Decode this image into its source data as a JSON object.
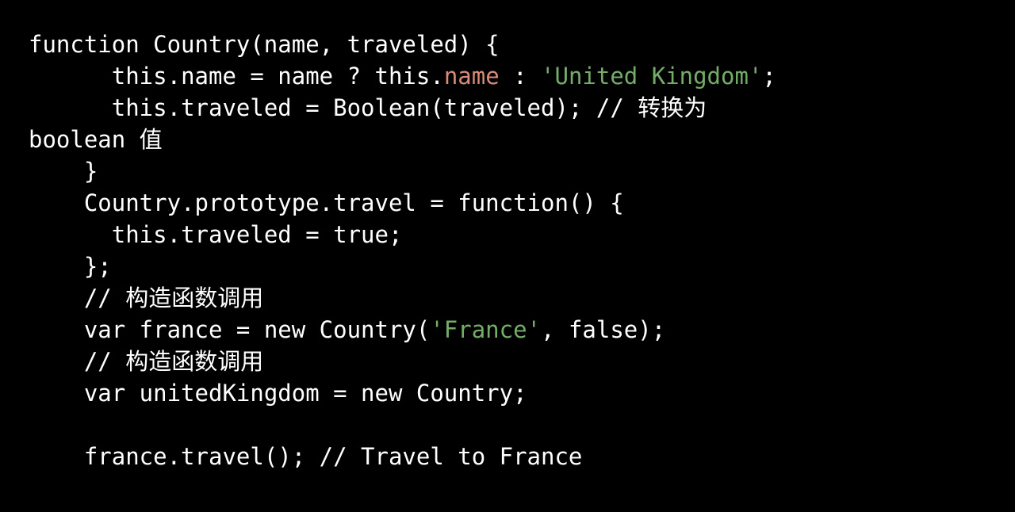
{
  "editor": {
    "background_color": "#000000",
    "default_text_color": "#ffffff",
    "property_color": "#d98c77",
    "string_color": "#74ad68",
    "font_size_px": 29,
    "line_height_px": 40,
    "language": "javascript"
  },
  "code": {
    "lines": [
      {
        "id": "line-1",
        "indent": "",
        "tokens": [
          {
            "kind": "plain",
            "text": "function Country(name, traveled) {"
          }
        ]
      },
      {
        "id": "line-2",
        "indent": "      ",
        "tokens": [
          {
            "kind": "plain",
            "text": "this."
          },
          {
            "kind": "plain",
            "text": "name = name ? this."
          },
          {
            "kind": "prop",
            "text": "name"
          },
          {
            "kind": "plain",
            "text": " : "
          },
          {
            "kind": "string",
            "text": "'United Kingdom'"
          },
          {
            "kind": "plain",
            "text": ";"
          }
        ]
      },
      {
        "id": "line-3",
        "indent": "      ",
        "tokens": [
          {
            "kind": "plain",
            "text": "this.traveled = Boolean(traveled); "
          },
          {
            "kind": "comment",
            "text": "// 转换为"
          }
        ]
      },
      {
        "id": "line-4-wrap",
        "indent": "",
        "tokens": [
          {
            "kind": "comment",
            "text": "boolean 值"
          }
        ]
      },
      {
        "id": "line-5",
        "indent": "    ",
        "tokens": [
          {
            "kind": "plain",
            "text": "}"
          }
        ]
      },
      {
        "id": "line-6",
        "indent": "    ",
        "tokens": [
          {
            "kind": "plain",
            "text": "Country.prototype.travel = function() {"
          }
        ]
      },
      {
        "id": "line-7",
        "indent": "      ",
        "tokens": [
          {
            "kind": "plain",
            "text": "this.traveled = true;"
          }
        ]
      },
      {
        "id": "line-8",
        "indent": "    ",
        "tokens": [
          {
            "kind": "plain",
            "text": "};"
          }
        ]
      },
      {
        "id": "line-9",
        "indent": "    ",
        "tokens": [
          {
            "kind": "comment",
            "text": "// 构造函数调用"
          }
        ]
      },
      {
        "id": "line-10",
        "indent": "    ",
        "tokens": [
          {
            "kind": "plain",
            "text": "var france = new Country("
          },
          {
            "kind": "string",
            "text": "'France'"
          },
          {
            "kind": "plain",
            "text": ", false);"
          }
        ]
      },
      {
        "id": "line-11",
        "indent": "    ",
        "tokens": [
          {
            "kind": "comment",
            "text": "// 构造函数调用"
          }
        ]
      },
      {
        "id": "line-12",
        "indent": "    ",
        "tokens": [
          {
            "kind": "plain",
            "text": "var unitedKingdom = new Country;"
          }
        ]
      },
      {
        "id": "line-13-blank",
        "indent": "",
        "tokens": []
      },
      {
        "id": "line-14",
        "indent": "    ",
        "tokens": [
          {
            "kind": "plain",
            "text": "france.travel(); "
          },
          {
            "kind": "comment",
            "text": "// Travel to France"
          }
        ]
      }
    ]
  }
}
